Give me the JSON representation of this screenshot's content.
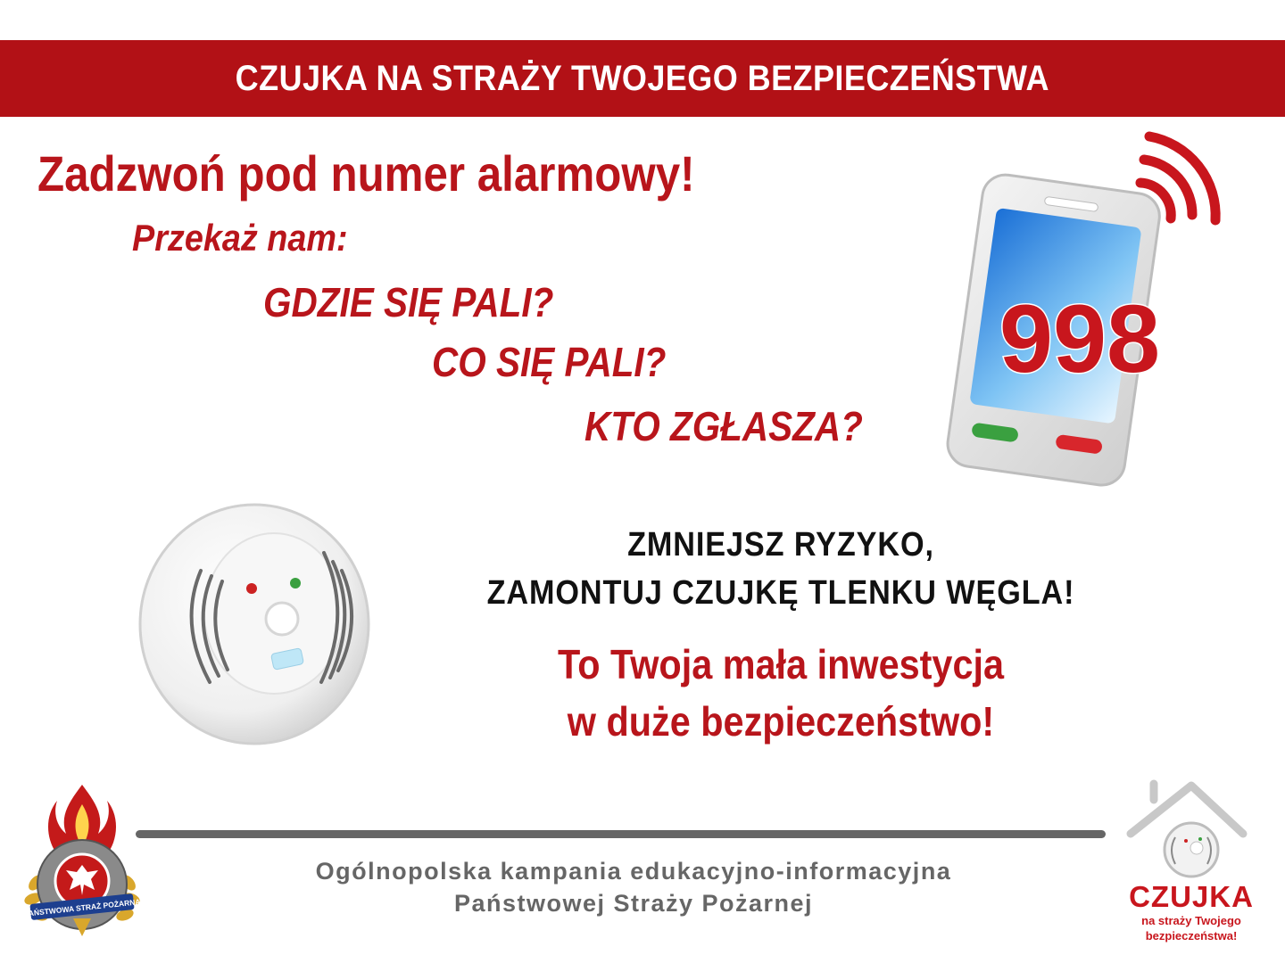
{
  "banner": {
    "title": "CZUJKA NA STRAŻY TWOJEGO BEZPIECZEŃSTWA"
  },
  "main": {
    "headline": "Zadzwoń pod numer alarmowy!",
    "subheading": "Przekaż nam:",
    "questions": [
      "GDZIE SIĘ PALI?",
      "CO SIĘ PALI?",
      "KTO ZGŁASZA?"
    ]
  },
  "phone": {
    "number": "998"
  },
  "message": {
    "line1": "ZMNIEJSZ RYZYKO,",
    "line2": "ZAMONTUJ CZUJKĘ TLENKU WĘGLA!",
    "line3": "To Twoja mała inwestycja",
    "line4": "w duże bezpieczeństwo!"
  },
  "footer": {
    "line1": "Ogólnopolska kampania edukacyjno-informacyjna",
    "line2": "Państwowej Straży Pożarnej"
  },
  "psp_logo": {
    "ring_text": "PAŃSTWOWA STRAŻ POŻARNA"
  },
  "campaign_logo": {
    "name": "CZUJKA",
    "tagline_1": "na straży Twojego",
    "tagline_2": "bezpieczeństwa!"
  },
  "colors": {
    "brand_red": "#b21116",
    "text_red": "#b8151b",
    "footer_gray": "#666666",
    "green_button": "#3aa040"
  }
}
